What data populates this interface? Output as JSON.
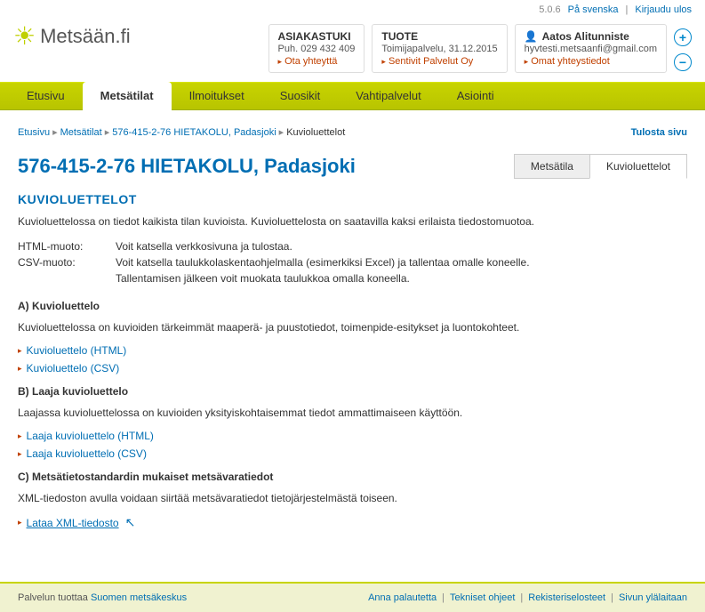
{
  "top": {
    "version": "5.0.6",
    "lang_link": "På svenska",
    "logout": "Kirjaudu ulos"
  },
  "logo_text": "Metsään.fi",
  "info_boxes": {
    "support": {
      "title": "ASIAKASTUKI",
      "sub": "Puh. 029 432 409",
      "link": "Ota yhteyttä"
    },
    "product": {
      "title": "TUOTE",
      "sub": "Toimijapalvelu, 31.12.2015",
      "link": "Sentivit Palvelut Oy"
    },
    "user": {
      "title": "Aatos Alitunniste",
      "sub": "hyvtesti.metsaanfi@gmail.com",
      "link": "Omat yhteystiedot"
    }
  },
  "nav": {
    "items": [
      "Etusivu",
      "Metsätilat",
      "Ilmoitukset",
      "Suosikit",
      "Vahtipalvelut",
      "Asiointi"
    ]
  },
  "breadcrumb": {
    "items": [
      "Etusivu",
      "Metsätilat",
      "576-415-2-76 HIETAKOLU, Padasjoki",
      "Kuvioluettelot"
    ],
    "print": "Tulosta sivu"
  },
  "page_title": "576-415-2-76 HIETAKOLU, Padasjoki",
  "tabs": {
    "metsatila": "Metsätila",
    "kuvioluettelot": "Kuvioluettelot"
  },
  "heading": "KUVIOLUETTELOT",
  "intro": "Kuvioluettelossa on tiedot kaikista tilan kuvioista. Kuvioluettelosta on saatavilla kaksi erilaista tiedostomuotoa.",
  "formats": {
    "html_label": "HTML-muoto:",
    "html_desc": "Voit katsella verkkosivuna ja tulostaa.",
    "csv_label": "CSV-muoto:",
    "csv_desc1": "Voit katsella taulukkolaskentaohjelmalla (esimerkiksi Excel) ja tallentaa omalle koneelle.",
    "csv_desc2": "Tallentamisen jälkeen voit muokata taulukkoa omalla koneella."
  },
  "section_a": {
    "title": "A) Kuvioluettelo",
    "desc": "Kuvioluettelossa on kuvioiden tärkeimmät maaperä- ja puustotiedot, toimenpide-esitykset ja luontokohteet.",
    "links": [
      "Kuvioluettelo (HTML)",
      "Kuvioluettelo (CSV)"
    ]
  },
  "section_b": {
    "title": "B) Laaja kuvioluettelo",
    "desc": "Laajassa kuvioluettelossa on kuvioiden yksityiskohtaisemmat tiedot ammattimaiseen käyttöön.",
    "links": [
      "Laaja kuvioluettelo (HTML)",
      "Laaja kuvioluettelo (CSV)"
    ]
  },
  "section_c": {
    "title": "C) Metsätietostandardin mukaiset metsävaratiedot",
    "desc": "XML-tiedoston avulla voidaan siirtää metsävaratiedot tietojärjestelmästä toiseen.",
    "link": "Lataa XML-tiedosto"
  },
  "footer": {
    "provider_label": "Palvelun tuottaa ",
    "provider_link": "Suomen metsäkeskus",
    "links": [
      "Anna palautetta",
      "Tekniset ohjeet",
      "Rekisteriselosteet",
      "Sivun ylälaitaan"
    ]
  }
}
